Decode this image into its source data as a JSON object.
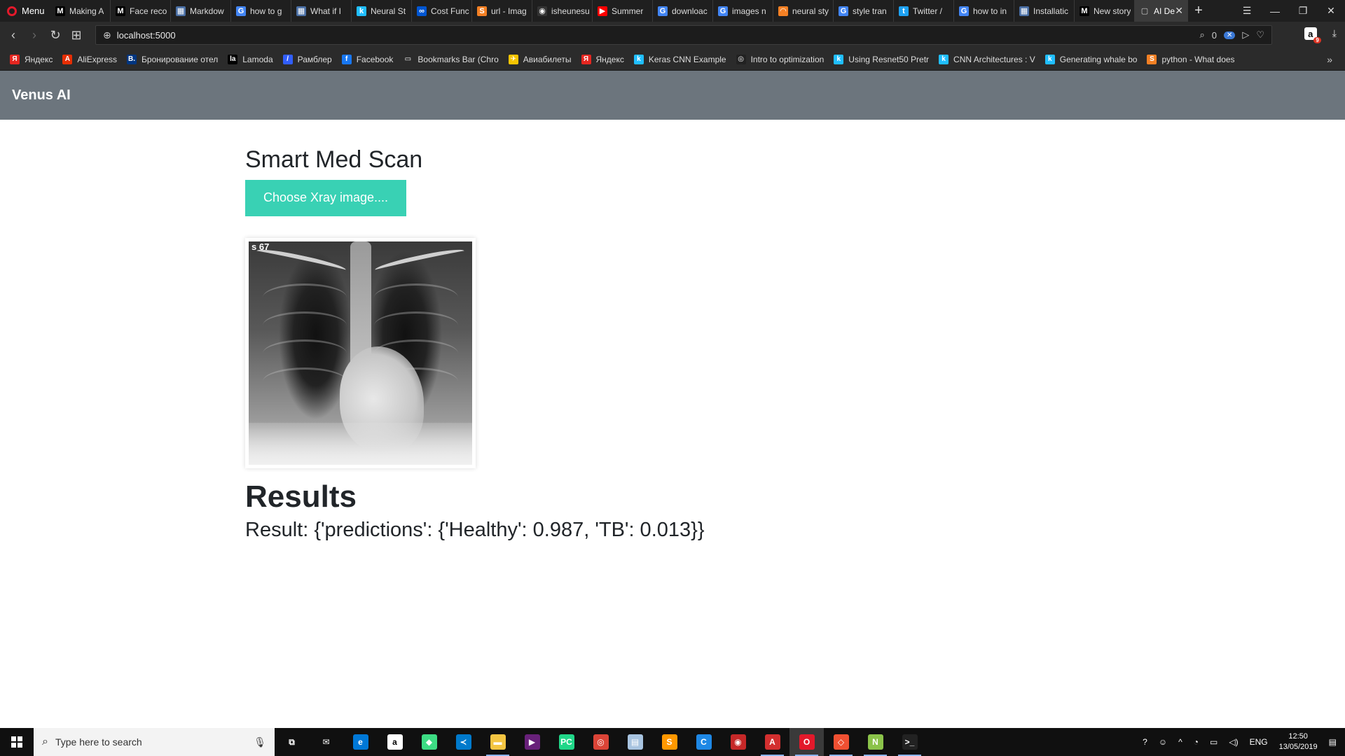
{
  "browser": {
    "menu_label": "Menu",
    "tabs": [
      {
        "title": "Making A",
        "icon": "M",
        "color": "#000000"
      },
      {
        "title": "Face reco",
        "icon": "M",
        "color": "#000000"
      },
      {
        "title": "Markdow",
        "icon": "▦",
        "color": "#4a6fa5"
      },
      {
        "title": "how to g",
        "icon": "G",
        "color": "#4285f4"
      },
      {
        "title": "What if I",
        "icon": "▦",
        "color": "#4a6fa5"
      },
      {
        "title": "Neural St",
        "icon": "k",
        "color": "#20beff"
      },
      {
        "title": "Cost Func",
        "icon": "∞",
        "color": "#0056d2"
      },
      {
        "title": "url - Imag",
        "icon": "S",
        "color": "#f48024"
      },
      {
        "title": "isheunesu",
        "icon": "◉",
        "color": "#333333"
      },
      {
        "title": "Summer",
        "icon": "▶",
        "color": "#ff0000"
      },
      {
        "title": "downloac",
        "icon": "G",
        "color": "#4285f4"
      },
      {
        "title": "images n",
        "icon": "G",
        "color": "#4285f4"
      },
      {
        "title": "neural sty",
        "icon": "◠",
        "color": "#f48024"
      },
      {
        "title": "style tran",
        "icon": "G",
        "color": "#4285f4"
      },
      {
        "title": "Twitter /",
        "icon": "t",
        "color": "#1da1f2"
      },
      {
        "title": "how to in",
        "icon": "G",
        "color": "#4285f4"
      },
      {
        "title": "Installatic",
        "icon": "▦",
        "color": "#4a6fa5"
      },
      {
        "title": "New story",
        "icon": "M",
        "color": "#000000"
      }
    ],
    "active_tab": {
      "title": "AI De",
      "icon": "▢"
    },
    "new_tab_label": "+",
    "url": "localhost:5000",
    "zero_count": "0",
    "amazon_badge": "9",
    "bookmarks": [
      {
        "label": "Яндекс",
        "icon": "Я",
        "color": "#e52620"
      },
      {
        "label": "AliExpress",
        "icon": "A",
        "color": "#e62e04"
      },
      {
        "label": "Бронирование отел",
        "icon": "B.",
        "color": "#003580"
      },
      {
        "label": "Lamoda",
        "icon": "la",
        "color": "#000000"
      },
      {
        "label": "Рамблер",
        "icon": "/",
        "color": "#315efb"
      },
      {
        "label": "Facebook",
        "icon": "f",
        "color": "#1877f2"
      },
      {
        "label": "Bookmarks Bar (Chro",
        "icon": "▭",
        "color": "#2b2b2b"
      },
      {
        "label": "Авиабилеты",
        "icon": "✈",
        "color": "#f5c400"
      },
      {
        "label": "Яндекс",
        "icon": "Я",
        "color": "#e52620"
      },
      {
        "label": "Keras CNN Example",
        "icon": "k",
        "color": "#20beff"
      },
      {
        "label": "Intro to optimization",
        "icon": "◎",
        "color": "#222222"
      },
      {
        "label": "Using Resnet50 Pretr",
        "icon": "k",
        "color": "#20beff"
      },
      {
        "label": "CNN Architectures : V",
        "icon": "k",
        "color": "#20beff"
      },
      {
        "label": "Generating whale bo",
        "icon": "k",
        "color": "#20beff"
      },
      {
        "label": "python - What does",
        "icon": "S",
        "color": "#f48024"
      }
    ],
    "more_bookmarks": "»"
  },
  "app": {
    "brand": "Venus AI",
    "title": "Smart Med Scan",
    "upload_label": "Choose Xray image....",
    "xray_mark": "s 67",
    "results_heading": "Results",
    "result_text": "Result: {'predictions': {'Healthy': 0.987, 'TB': 0.013}}",
    "colors": {
      "navbar": "#6c757d",
      "button": "#39d1b4"
    }
  },
  "taskbar": {
    "search_placeholder": "Type here to search",
    "apps": [
      {
        "name": "task-view",
        "icon": "⧉",
        "color": "#101010",
        "running": false
      },
      {
        "name": "mail",
        "icon": "✉",
        "color": "#101010",
        "running": false
      },
      {
        "name": "edge",
        "icon": "e",
        "color": "#0078d7",
        "running": false
      },
      {
        "name": "amazon",
        "icon": "a",
        "color": "#ffffff",
        "running": false
      },
      {
        "name": "android-studio",
        "icon": "◆",
        "color": "#3ddc84",
        "running": false
      },
      {
        "name": "vscode",
        "icon": "≺",
        "color": "#007acc",
        "running": false
      },
      {
        "name": "file-explorer",
        "icon": "▬",
        "color": "#f4c542",
        "running": true
      },
      {
        "name": "visual-studio",
        "icon": "▶",
        "color": "#68217a",
        "running": false
      },
      {
        "name": "pycharm",
        "icon": "PC",
        "color": "#21d789",
        "running": false
      },
      {
        "name": "chrome",
        "icon": "◎",
        "color": "#db4437",
        "running": false
      },
      {
        "name": "notepad",
        "icon": "▤",
        "color": "#a8c4e0",
        "running": false
      },
      {
        "name": "sublime",
        "icon": "S",
        "color": "#ff9800",
        "running": false
      },
      {
        "name": "ccleaner",
        "icon": "C",
        "color": "#1e88e5",
        "running": false
      },
      {
        "name": "antivirus",
        "icon": "◉",
        "color": "#c62828",
        "running": false
      },
      {
        "name": "acrobat",
        "icon": "A",
        "color": "#d32f2f",
        "running": true
      },
      {
        "name": "opera",
        "icon": "O",
        "color": "#e3192b",
        "running": true
      },
      {
        "name": "git",
        "icon": "◇",
        "color": "#f05032",
        "running": true
      },
      {
        "name": "notepad-plus",
        "icon": "N",
        "color": "#8bc34a",
        "running": true
      },
      {
        "name": "terminal",
        "icon": ">_",
        "color": "#222222",
        "running": true
      }
    ],
    "lang": "ENG",
    "time": "12:50",
    "date": "13/05/2019"
  }
}
